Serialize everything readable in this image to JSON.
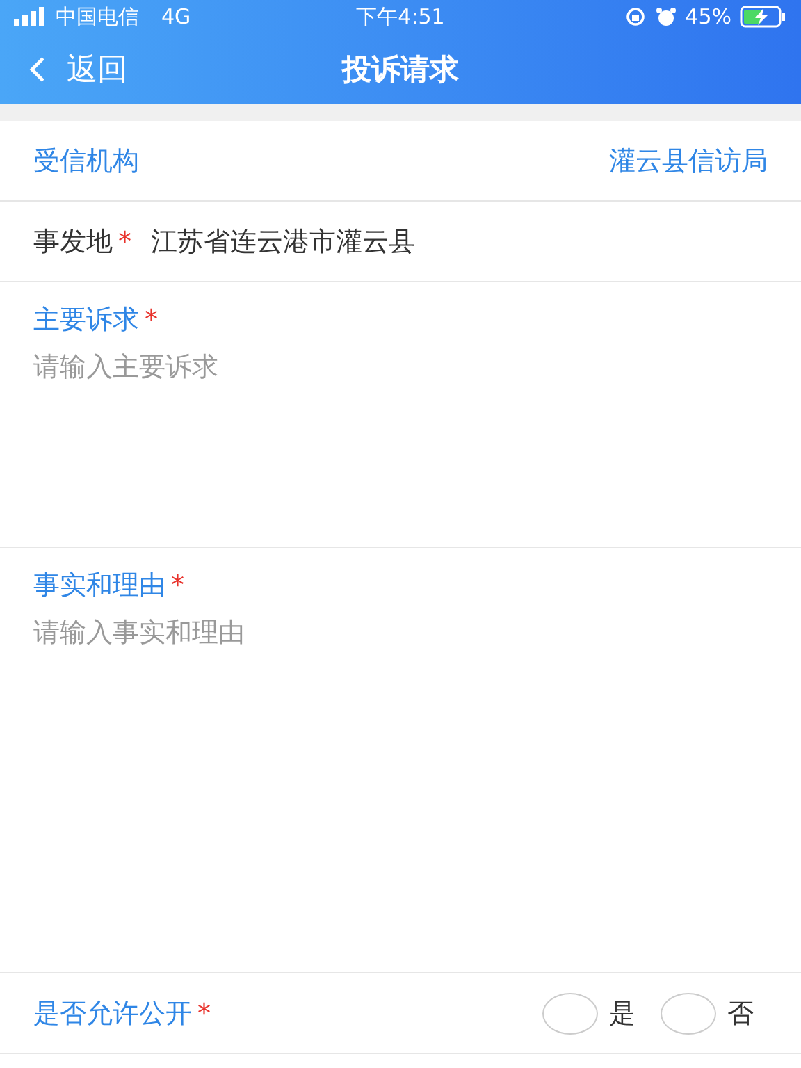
{
  "status_bar": {
    "carrier": "中国电信",
    "network": "4G",
    "time": "下午4:51",
    "battery": "45%"
  },
  "nav": {
    "back": "返回",
    "title": "投诉请求"
  },
  "agency": {
    "label": "受信机构",
    "value": "灌云县信访局"
  },
  "location": {
    "label": "事发地",
    "mark": "*",
    "value": "江苏省连云港市灌云县"
  },
  "text_fields": [
    {
      "label": "主要诉求",
      "mark": "*",
      "placeholder": "请输入主要诉求"
    },
    {
      "label": "事实和理由",
      "mark": "*",
      "placeholder": "请输入事实和理由"
    }
  ],
  "public": {
    "label": "是否允许公开",
    "mark": "*",
    "options": [
      {
        "label": "是",
        "selected": false
      },
      {
        "label": "否",
        "selected": false
      }
    ]
  }
}
